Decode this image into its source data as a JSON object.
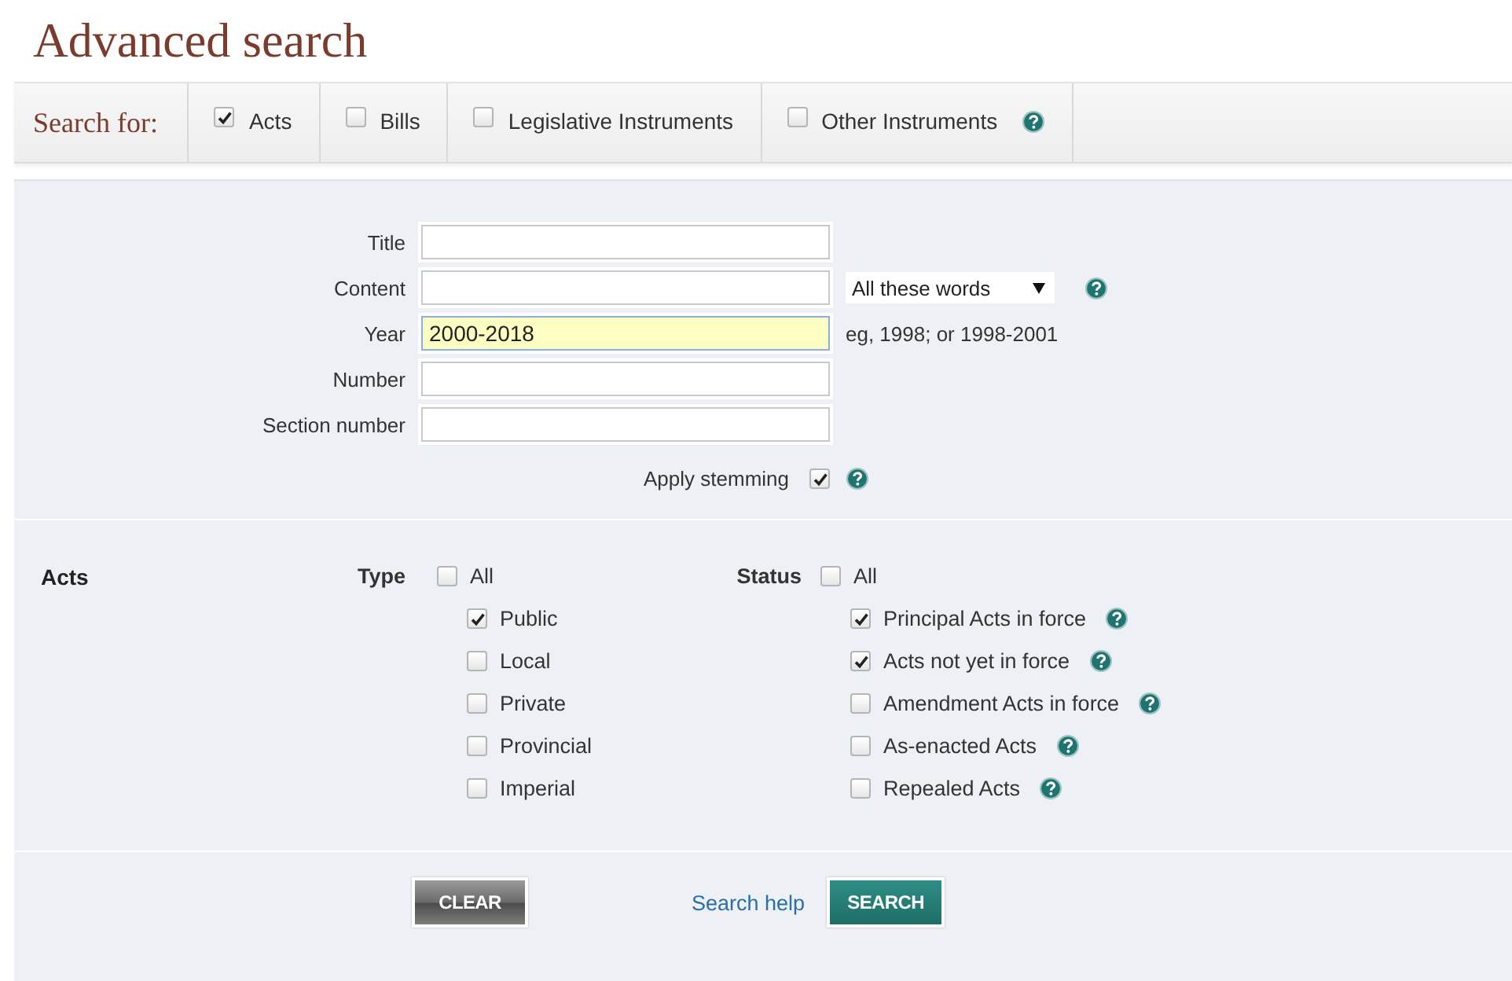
{
  "title": "Advanced search",
  "search_for": {
    "label": "Search for:",
    "options": [
      {
        "label": "Acts",
        "checked": true,
        "help": false
      },
      {
        "label": "Bills",
        "checked": false,
        "help": false
      },
      {
        "label": "Legislative Instruments",
        "checked": false,
        "help": false
      },
      {
        "label": "Other Instruments",
        "checked": false,
        "help": true
      }
    ]
  },
  "fields": [
    {
      "label": "Title",
      "focused": false
    },
    {
      "label": "Content",
      "focused": false,
      "match": {
        "value": "All these words",
        "help": true
      }
    },
    {
      "label": "Year",
      "value": "2000-2018",
      "focused": true,
      "hint": "eg, 1998; or 1998-2001"
    },
    {
      "label": "Number",
      "focused": false
    },
    {
      "label": "Section number",
      "focused": false
    }
  ],
  "stemming": {
    "label": "Apply stemming",
    "checked": true,
    "help": true
  },
  "acts": {
    "heading": "Acts",
    "groups": [
      {
        "label": "Type",
        "all": {
          "label": "All",
          "checked": false
        },
        "options": [
          {
            "label": "Public",
            "checked": true,
            "help": false
          },
          {
            "label": "Local",
            "checked": false,
            "help": false
          },
          {
            "label": "Private",
            "checked": false,
            "help": false
          },
          {
            "label": "Provincial",
            "checked": false,
            "help": false
          },
          {
            "label": "Imperial",
            "checked": false,
            "help": false
          }
        ]
      },
      {
        "label": "Status",
        "all": {
          "label": "All",
          "checked": false
        },
        "options": [
          {
            "label": "Principal Acts in force",
            "checked": true,
            "help": true
          },
          {
            "label": "Acts not yet in force",
            "checked": true,
            "help": true
          },
          {
            "label": "Amendment Acts in force",
            "checked": false,
            "help": true
          },
          {
            "label": "As-enacted Acts",
            "checked": false,
            "help": true
          },
          {
            "label": "Repealed Acts",
            "checked": false,
            "help": true
          }
        ]
      }
    ]
  },
  "actions": [
    {
      "kind": "clear",
      "label": "CLEAR"
    },
    {
      "kind": "link",
      "label": "Search help"
    },
    {
      "kind": "submit",
      "label": "SEARCH"
    }
  ]
}
